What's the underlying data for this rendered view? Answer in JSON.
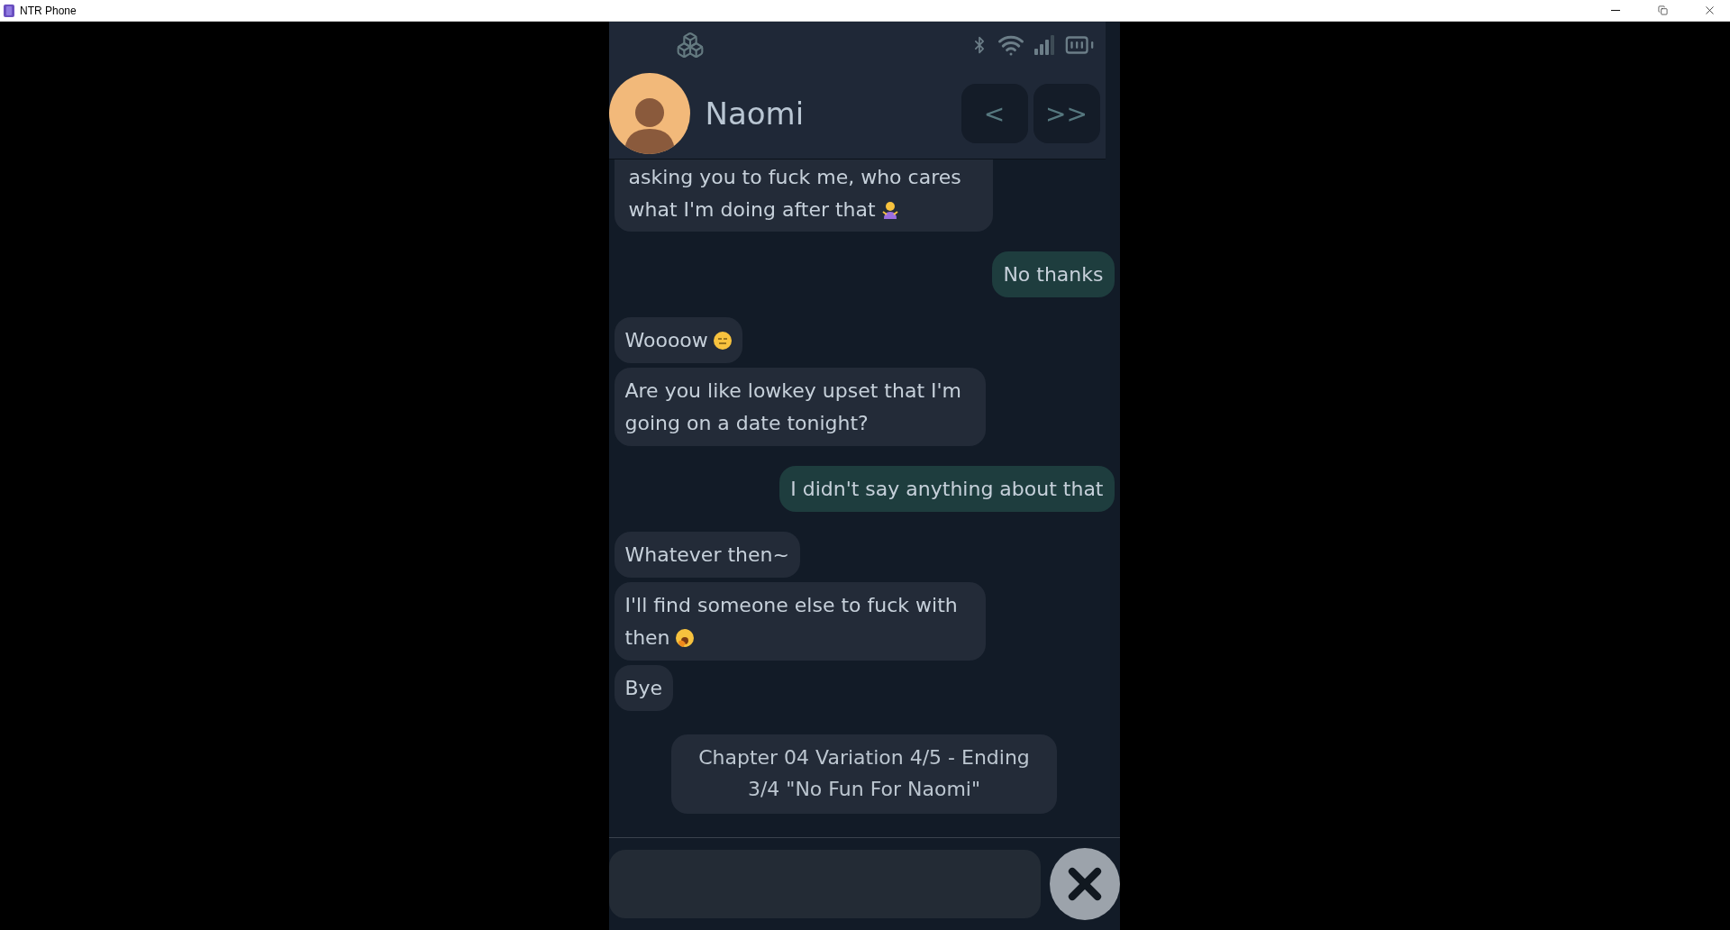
{
  "window": {
    "title": "NTR Phone"
  },
  "contact": {
    "name": "Naomi"
  },
  "nav_buttons": [
    "<",
    ">>"
  ],
  "messages": [
    {
      "kind": "received",
      "text": "asking you to fuck me, who cares what I'm doing after that"
    },
    {
      "kind": "sent",
      "text": "No thanks"
    },
    {
      "kind": "received",
      "text": "Woooow"
    },
    {
      "kind": "received",
      "text": "Are you like lowkey upset that I'm going on a date tonight?"
    },
    {
      "kind": "sent",
      "text": "I didn't say anything about that"
    },
    {
      "kind": "received",
      "text": "Whatever then~"
    },
    {
      "kind": "received",
      "text": "I'll find someone else to fuck with then"
    },
    {
      "kind": "received",
      "text": "Bye"
    }
  ],
  "chapter_note": "Chapter 04 Variation 4/5 - Ending 3/4 \"No Fun For Naomi\""
}
